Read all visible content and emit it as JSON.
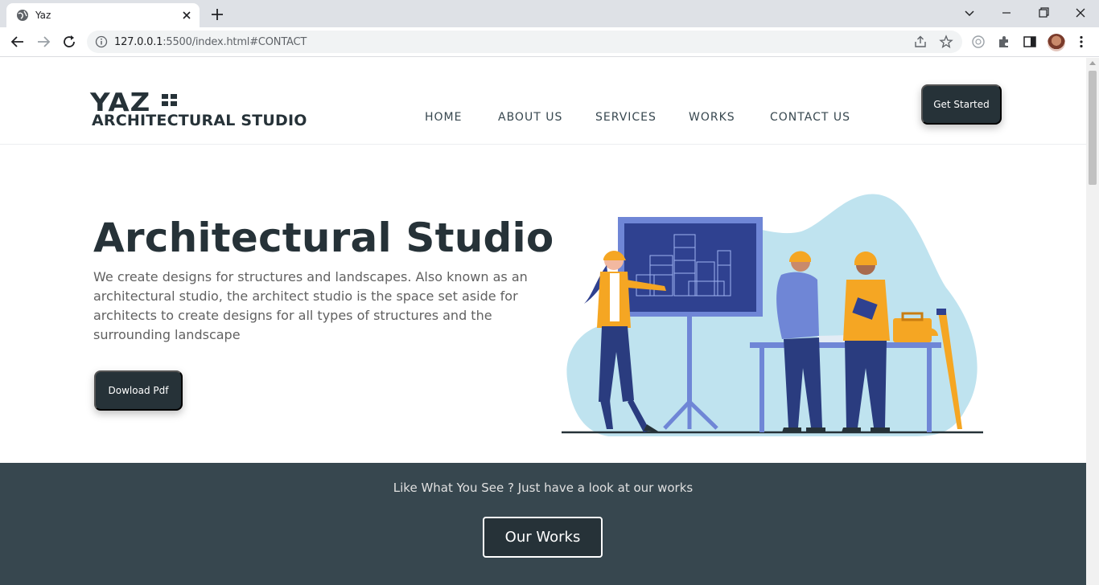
{
  "browser": {
    "tab_title": "Yaz",
    "url_host": "127.0.0.1",
    "url_rest": ":5500/index.html#CONTACT"
  },
  "header": {
    "logo_top": "YAZ",
    "logo_bottom": "ARCHITECTURAL STUDIO",
    "nav": [
      "HOME",
      "ABOUT US",
      "SERVICES",
      "WORKS",
      "CONTACT US"
    ],
    "cta_label": "Get Started"
  },
  "hero": {
    "title": "Architectural Studio",
    "description": "We create designs for structures and landscapes. Also known as an architectural studio, the architect studio is the space set aside for architects to create designs for all types of structures and the surrounding landscape",
    "download_label": "Dowload Pdf"
  },
  "works_band": {
    "text": "Like What You See ? Just have a look at our works",
    "button_label": "Our Works"
  },
  "colors": {
    "brand_dark": "#263238",
    "band_bg": "#37474f",
    "illustration_bg": "#bfe3ef",
    "accent_orange": "#f5a623",
    "accent_blue": "#2f4190"
  }
}
